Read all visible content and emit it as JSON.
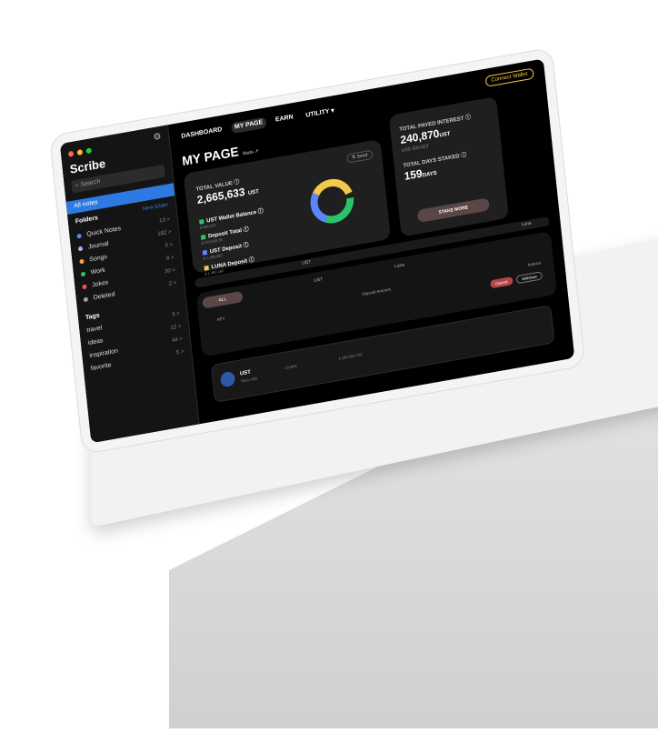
{
  "app": {
    "sidebar": {
      "title": "Scribe",
      "search_placeholder": "Search",
      "all_notes": "All notes",
      "folders_label": "Folders",
      "new_folder": "New folder",
      "folders": [
        {
          "name": "Quick Notes",
          "count": "13 >",
          "color": "#5b84ff"
        },
        {
          "name": "Journal",
          "count": "182 >",
          "color": "#b9a6ff"
        },
        {
          "name": "Songs",
          "count": "3 >",
          "color": "#f2a33a"
        },
        {
          "name": "Work",
          "count": "8 >",
          "color": "#2bc36a"
        },
        {
          "name": "Jokes",
          "count": "30 >",
          "color": "#ff4d4d"
        },
        {
          "name": "Deleted",
          "count": "2 >",
          "color": "#9aa0a6"
        }
      ],
      "tags_label": "Tags",
      "tags": [
        {
          "name": "travel",
          "count": "5 >"
        },
        {
          "name": "ideas",
          "count": "12 >"
        },
        {
          "name": "inspiration",
          "count": "44 >"
        },
        {
          "name": "favorite",
          "count": "5 >"
        }
      ]
    },
    "topnav": {
      "items": [
        "DASHBOARD",
        "MY PAGE",
        "EARN",
        "UTILITY ▾"
      ],
      "connect": "Connect Wallet"
    },
    "page": {
      "title": "MY PAGE",
      "title_badge": "Stats ↗",
      "total_value_label": "TOTAL VALUE ⓘ",
      "total_value": "2,665,633",
      "total_value_unit": "UST",
      "send_chip": "⇅ Send",
      "legend": [
        {
          "label": "UST Wallet Balance ⓘ",
          "amount": "$ 800,632",
          "color": "#2bc36a"
        },
        {
          "label": "Deposit Total ⓘ",
          "amount": "$ 379,538.59",
          "color": "#2bc36a"
        },
        {
          "label": "UST Deposit ⓘ",
          "amount": "$ 1,190,360",
          "color": "#5b84ff"
        },
        {
          "label": "LUNA Deposit ⓘ",
          "amount": "$ 1,490,360",
          "color": "#f2c94c"
        }
      ],
      "interest_label": "TOTAL PAYED INTEREST ⓘ",
      "interest_value": "240,870",
      "interest_unit": "UST",
      "interest_usd": "USD 600,823",
      "days_label": "TOTAL DAYS STAKED ⓘ",
      "days_value": "159",
      "days_unit": "DAYS",
      "stake_more": "STAKE MORE",
      "pool_labels": [
        "UST",
        "Luna"
      ],
      "tabs": [
        "ALL",
        "UST",
        "Luna"
      ],
      "table_headers": [
        "APY",
        "Deposit Amount",
        "Actions"
      ],
      "actions": [
        "Deposit",
        "Withdraw"
      ],
      "row": {
        "token": "UST",
        "sub": "Terra USD",
        "apy": "19.50%",
        "amount": "1,190,360 UST"
      }
    }
  }
}
